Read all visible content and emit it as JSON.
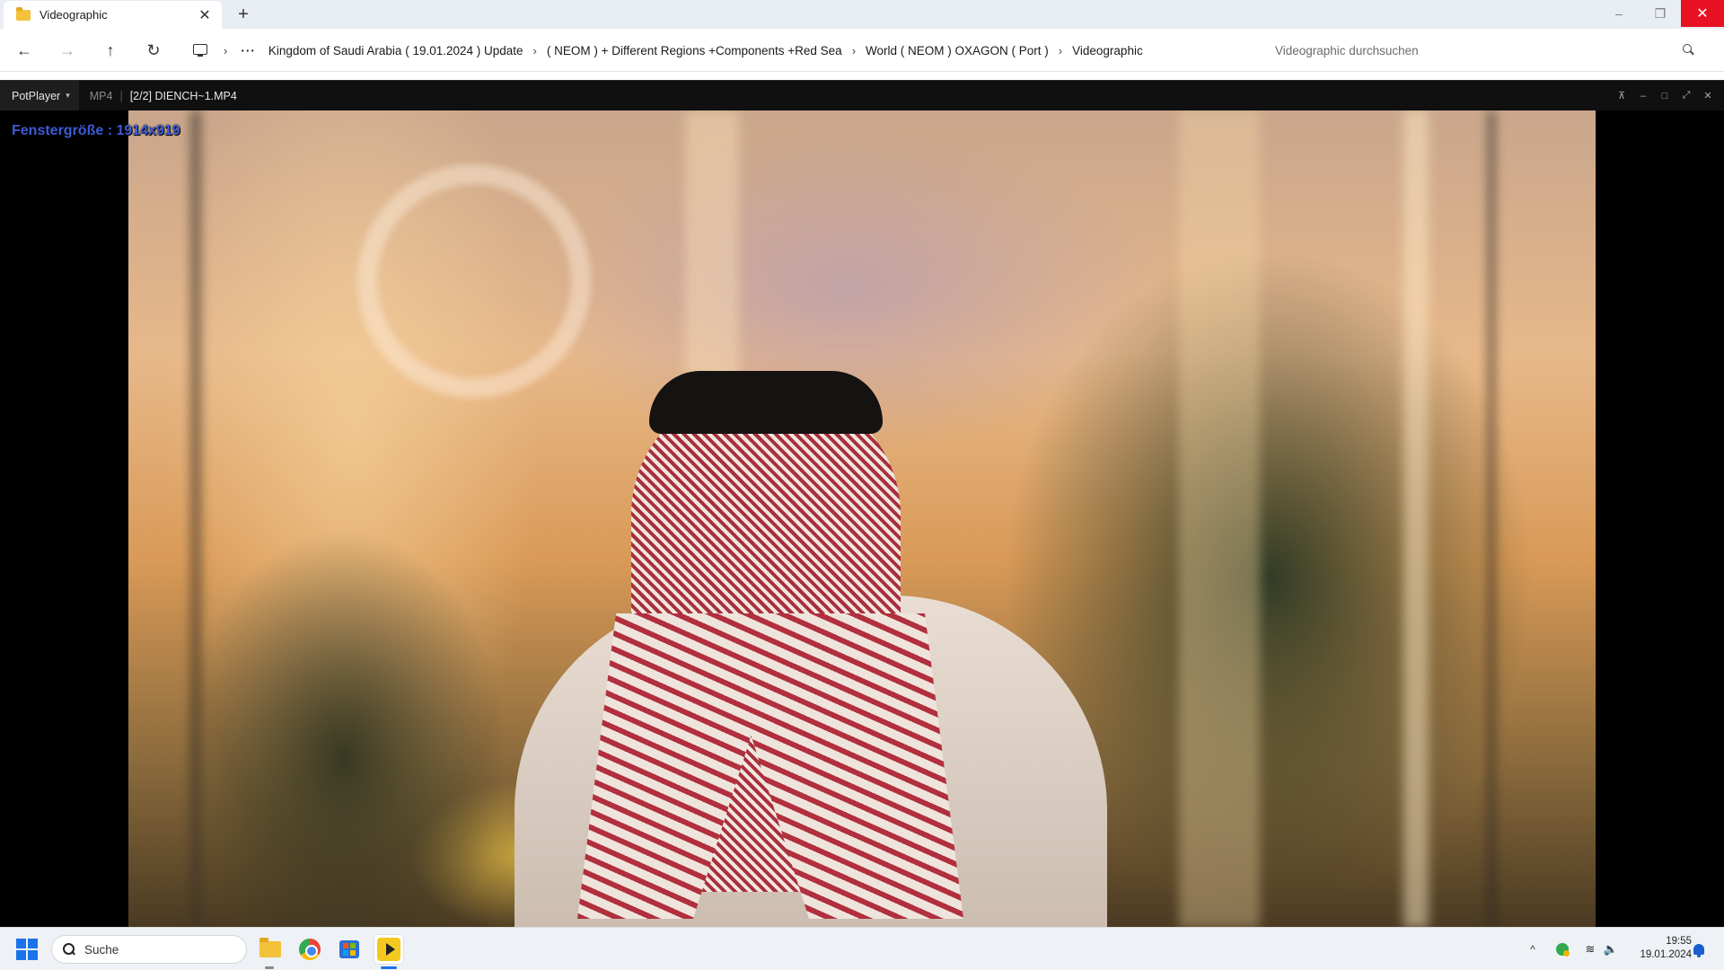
{
  "explorer": {
    "tab": {
      "title": "Videographic",
      "close": "✕"
    },
    "new_tab": "+",
    "window": {
      "minimize": "–",
      "restore": "❐",
      "close": "✕"
    },
    "nav": {
      "back": "←",
      "forward": "→",
      "up": "↑",
      "refresh": "↻"
    },
    "breadcrumb": {
      "more": "···",
      "separator": "›",
      "items": [
        "Kingdom of Saudi Arabia ( 19.01.2024 ) Update",
        "( NEOM ) + Different Regions +Components +Red Sea",
        "World ( NEOM ) OXAGON ( Port )",
        "Videographic"
      ]
    },
    "search": {
      "placeholder": "Videographic durchsuchen"
    }
  },
  "player": {
    "brand": "PotPlayer",
    "format": "MP4",
    "title": "[2/2] DIENCH~1.MP4",
    "overlay": "Fenstergröße : 1914x919",
    "controls": {
      "pin": "⊼",
      "minimize": "–",
      "maximize": "□",
      "fullscreen": "⤢",
      "close": "✕"
    }
  },
  "taskbar": {
    "search_placeholder": "Suche",
    "clock": {
      "time": "19:55",
      "date": "19.01.2024"
    },
    "tray": {
      "chevron": "^",
      "wifi": "≋",
      "volume": "🔈"
    }
  },
  "colors": {
    "accent": "#1a73e8",
    "close_red": "#e81123",
    "overlay_text": "#3c5bd6",
    "potplayer_yellow": "#f3c81f"
  }
}
